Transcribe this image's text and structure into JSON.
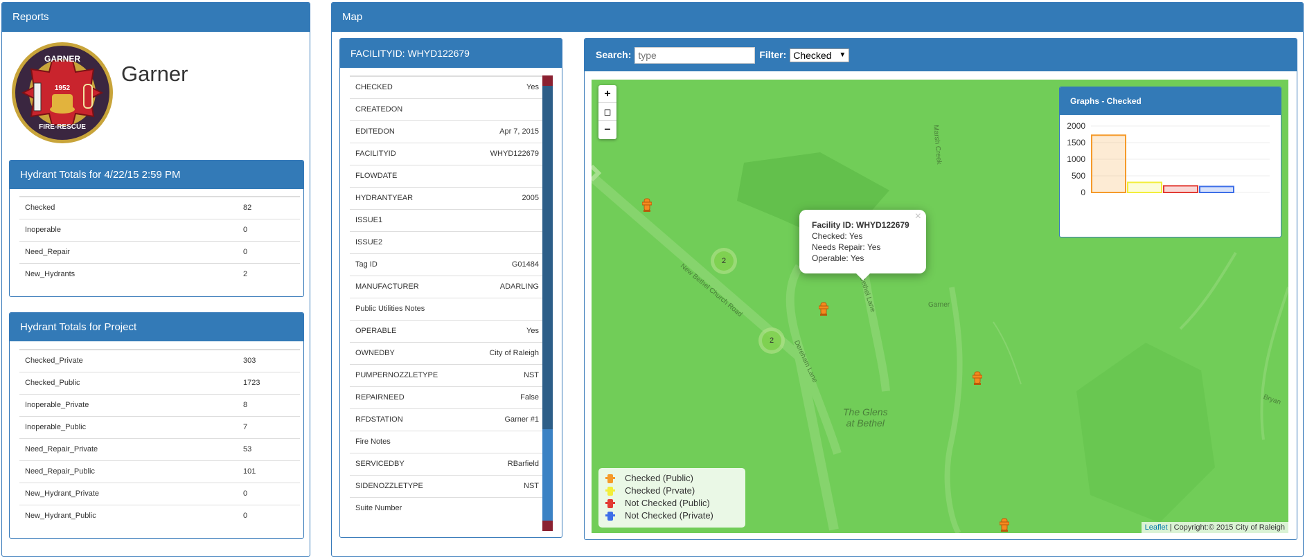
{
  "reports": {
    "title": "Reports",
    "logo": {
      "top": "GARNER",
      "year": "1952",
      "bottom": "FIRE-RESCUE"
    },
    "city_name": "Garner",
    "totals_date_title": "Hydrant Totals for 4/22/15 2:59 PM",
    "totals_date": [
      {
        "label": "Checked",
        "value": "82"
      },
      {
        "label": "Inoperable",
        "value": "0"
      },
      {
        "label": "Need_Repair",
        "value": "0"
      },
      {
        "label": "New_Hydrants",
        "value": "2"
      }
    ],
    "totals_project_title": "Hydrant Totals for Project",
    "totals_project": [
      {
        "label": "Checked_Private",
        "value": "303"
      },
      {
        "label": "Checked_Public",
        "value": "1723"
      },
      {
        "label": "Inoperable_Private",
        "value": "8"
      },
      {
        "label": "Inoperable_Public",
        "value": "7"
      },
      {
        "label": "Need_Repair_Private",
        "value": "53"
      },
      {
        "label": "Need_Repair_Public",
        "value": "101"
      },
      {
        "label": "New_Hydrant_Private",
        "value": "0"
      },
      {
        "label": "New_Hydrant_Public",
        "value": "0"
      }
    ]
  },
  "map_panel": {
    "title": "Map",
    "facility_title": "FACILITYID: WHYD122679",
    "attributes": [
      {
        "key": "CHECKED",
        "value": "Yes"
      },
      {
        "key": "CREATEDON",
        "value": ""
      },
      {
        "key": "EDITEDON",
        "value": "Apr 7, 2015"
      },
      {
        "key": "FACILITYID",
        "value": "WHYD122679"
      },
      {
        "key": "FLOWDATE",
        "value": ""
      },
      {
        "key": "HYDRANTYEAR",
        "value": "2005"
      },
      {
        "key": "ISSUE1",
        "value": ""
      },
      {
        "key": "ISSUE2",
        "value": ""
      },
      {
        "key": "Tag ID",
        "value": "G01484"
      },
      {
        "key": "MANUFACTURER",
        "value": "ADARLING"
      },
      {
        "key": "Public Utilities Notes",
        "value": ""
      },
      {
        "key": "OPERABLE",
        "value": "Yes"
      },
      {
        "key": "OWNEDBY",
        "value": "City of Raleigh"
      },
      {
        "key": "PUMPERNOZZLETYPE",
        "value": "NST"
      },
      {
        "key": "REPAIRNEED",
        "value": "False"
      },
      {
        "key": "RFDSTATION",
        "value": "Garner #1"
      },
      {
        "key": "Fire Notes",
        "value": ""
      },
      {
        "key": "SERVICEDBY",
        "value": "RBarfield"
      },
      {
        "key": "SIDENOZZLETYPE",
        "value": "NST"
      },
      {
        "key": "Suite Number",
        "value": ""
      }
    ],
    "search_label": "Search:",
    "search_placeholder": "type",
    "filter_label": "Filter:",
    "filter_value": "Checked",
    "zoom_in": "+",
    "layers": "◻",
    "zoom_out": "−",
    "clusters": [
      "2",
      "2"
    ],
    "map_labels": {
      "road1": "New Bethel Church Road",
      "road2": "Dereham Lane",
      "road3": "Bethel Lane",
      "place": "The Glens\nat Bethel",
      "town": "Garner",
      "bryan": "Bryan",
      "creek": "Marsh Creek"
    },
    "popup": {
      "close": "×",
      "facility": "Facility ID: WHYD122679",
      "checked": "Checked: Yes",
      "repair": "Needs Repair: Yes",
      "operable": "Operable: Yes"
    },
    "legend": [
      {
        "label": "Checked (Public)",
        "color": "#f59a2a"
      },
      {
        "label": "Checked (Prvate)",
        "color": "#f2ee3a"
      },
      {
        "label": "Not Checked (Public)",
        "color": "#e23b34"
      },
      {
        "label": "Not Checked (Private)",
        "color": "#3d6ee8"
      }
    ],
    "attribution_link": "Leaflet",
    "attribution_text": " | Copyright:© 2015 City of Raleigh"
  },
  "chart_data": {
    "type": "bar",
    "title": "Graphs - Checked",
    "categories": [
      "Checked (Public)",
      "Checked (Prvate)",
      "Not Checked (Public)",
      "Not Checked (Private)"
    ],
    "values": [
      1723,
      303,
      200,
      180
    ],
    "colors": [
      "#f59a2a",
      "#f2ee3a",
      "#e23b34",
      "#3d6ee8"
    ],
    "yticks": [
      0,
      500,
      1000,
      1500,
      2000
    ],
    "ylim": [
      0,
      2000
    ],
    "grid": true
  }
}
